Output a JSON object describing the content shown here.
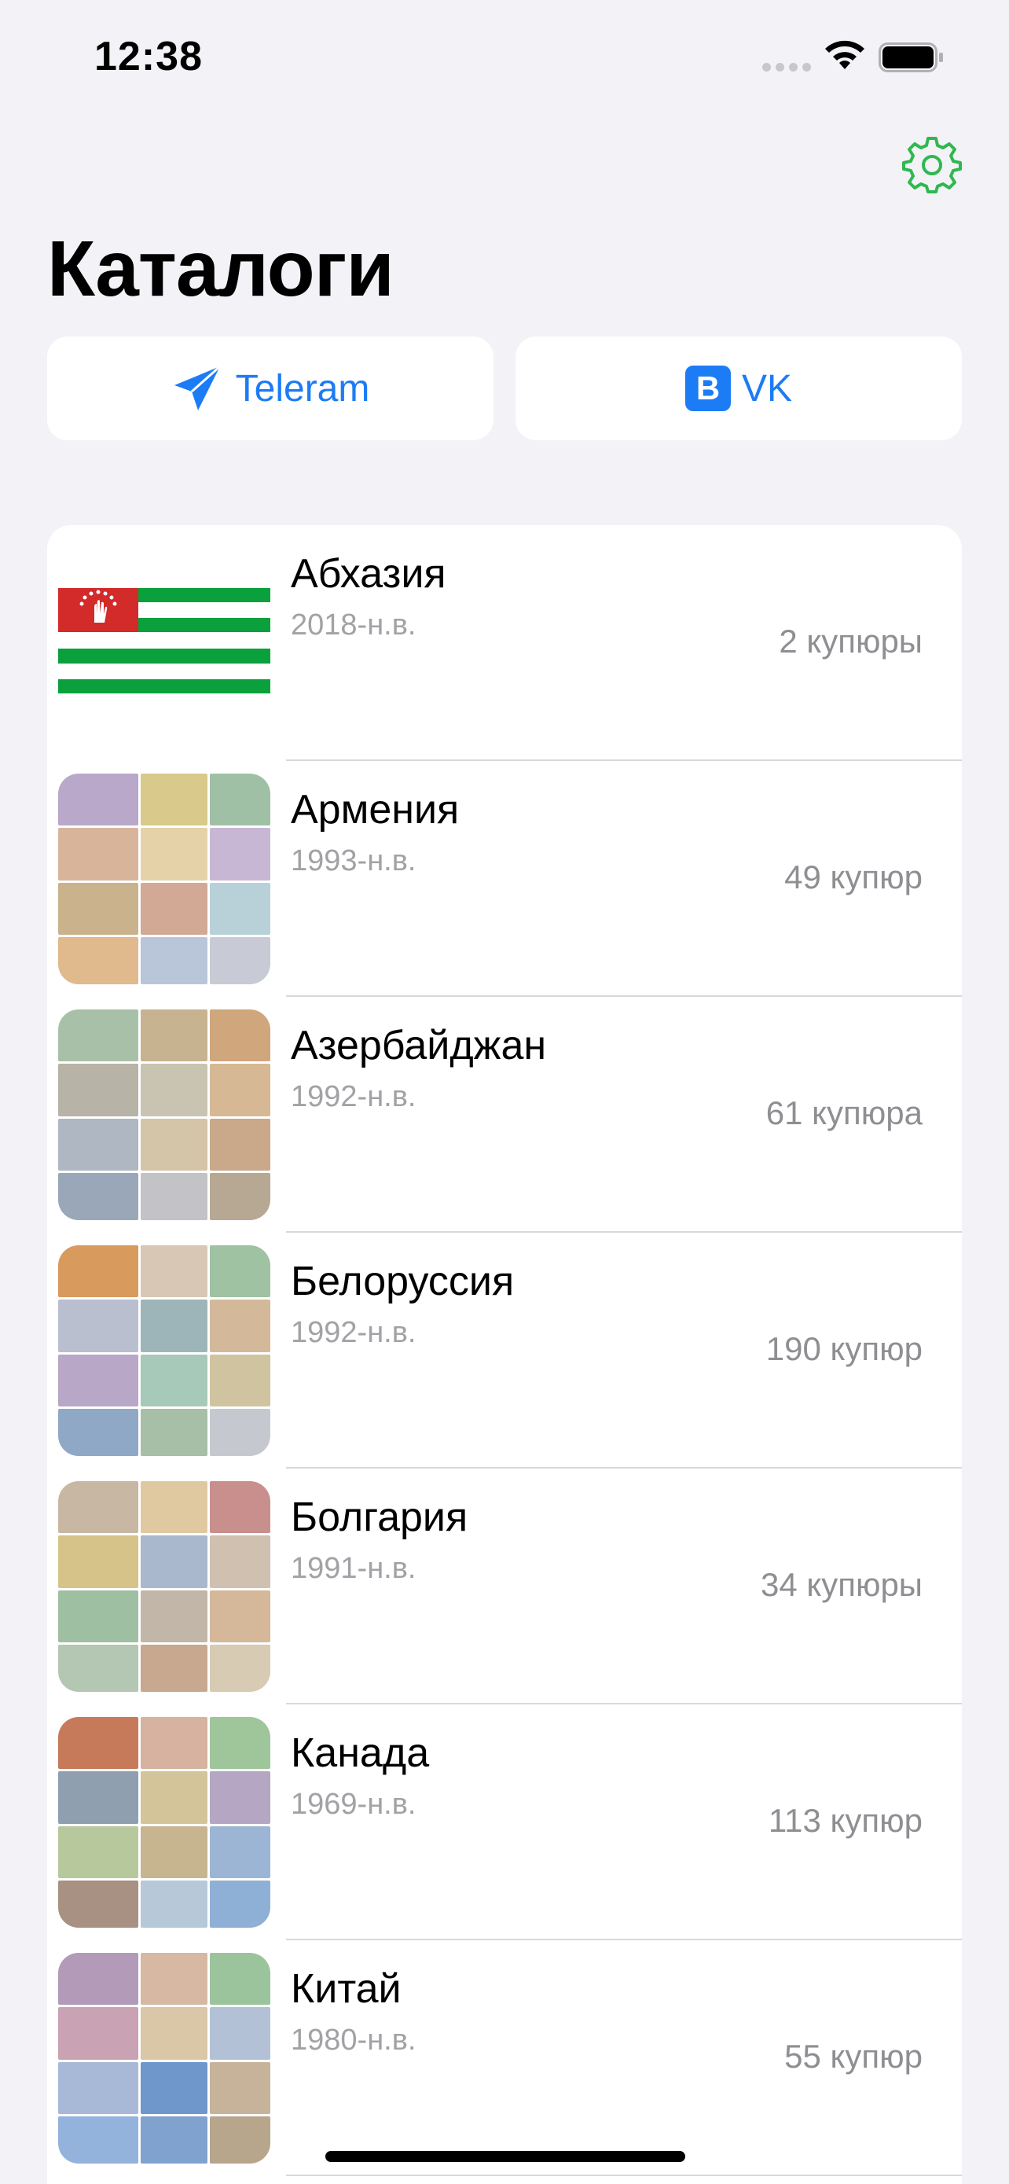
{
  "status": {
    "time": "12:38"
  },
  "header": {
    "title": "Каталоги"
  },
  "social": {
    "telegram_label": "Teleram",
    "vk_badge": "B",
    "vk_label": "VK"
  },
  "colors": {
    "accent": "#1c7cf5",
    "settings": "#2fb84f",
    "abkhazia_green": "#0aa03c",
    "abkhazia_red": "#d32a2a"
  },
  "icons": {
    "settings": "gear-icon",
    "telegram": "paper-plane-icon",
    "vk": "vk-icon"
  },
  "catalogs": [
    {
      "name": "Абхазия",
      "years": "2018-н.в.",
      "count": "2 купюры",
      "thumb": "abkhazia-flag"
    },
    {
      "name": "Армения",
      "years": "1993-н.в.",
      "count": "49 купюр",
      "thumb": "banknote-collage"
    },
    {
      "name": "Азербайджан",
      "years": "1992-н.в.",
      "count": "61 купюра",
      "thumb": "banknote-collage"
    },
    {
      "name": "Белоруссия",
      "years": "1992-н.в.",
      "count": "190 купюр",
      "thumb": "banknote-collage"
    },
    {
      "name": "Болгария",
      "years": "1991-н.в.",
      "count": "34 купюры",
      "thumb": "banknote-collage"
    },
    {
      "name": "Канада",
      "years": "1969-н.в.",
      "count": "113 купюр",
      "thumb": "banknote-collage"
    },
    {
      "name": "Китай",
      "years": "1980-н.в.",
      "count": "55 купюр",
      "thumb": "banknote-collage"
    }
  ]
}
